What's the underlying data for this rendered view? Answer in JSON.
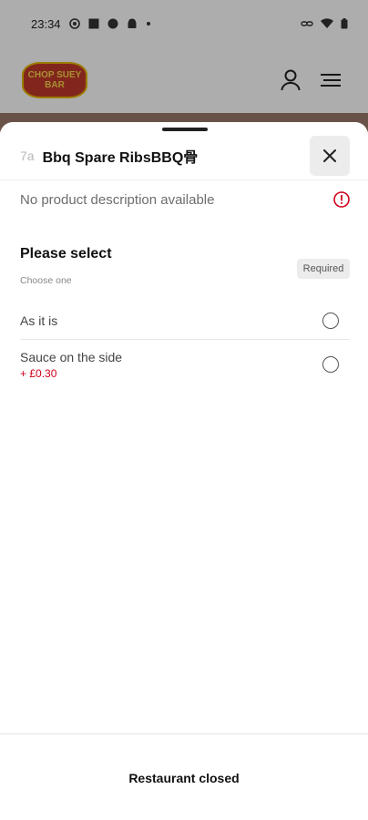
{
  "status_bar": {
    "time": "23:34"
  },
  "app": {
    "logo_text": "CHOP SUEY BAR"
  },
  "sheet": {
    "item_code": "7a",
    "item_title": "Bbq Spare RibsBBQ骨",
    "description": "No product description available",
    "section": {
      "title": "Please select",
      "subtitle": "Choose one",
      "badge": "Required"
    },
    "options": [
      {
        "label": "As it is",
        "price": ""
      },
      {
        "label": "Sauce on the side",
        "price": "+ £0.30"
      }
    ],
    "footer_label": "Restaurant closed"
  },
  "colors": {
    "accent": "#d0021b",
    "info_icon": "#d0021b"
  },
  "icons": [
    "profile-icon",
    "menu-icon",
    "close-icon",
    "info-icon"
  ]
}
